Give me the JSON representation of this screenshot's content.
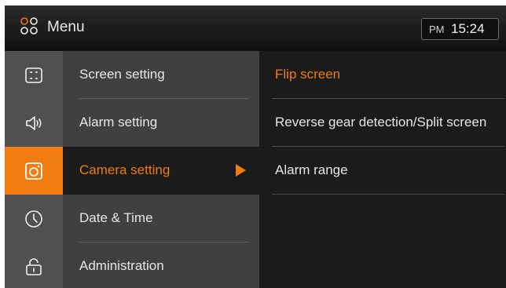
{
  "header": {
    "title": "Menu",
    "menu_icon": "grid-circles-icon",
    "clock": {
      "ampm": "PM",
      "time": "15:24"
    }
  },
  "sidebar": {
    "items": [
      {
        "icon": "screen-icon",
        "label": "Screen setting"
      },
      {
        "icon": "speaker-icon",
        "label": "Alarm setting"
      },
      {
        "icon": "camera-icon",
        "label": "Camera setting"
      },
      {
        "icon": "clock-icon",
        "label": "Date & Time"
      },
      {
        "icon": "lock-icon",
        "label": "Administration"
      }
    ],
    "selected_index": 2
  },
  "submenu": {
    "items": [
      {
        "label": "Flip screen"
      },
      {
        "label": "Reverse gear detection/Split screen"
      },
      {
        "label": "Alarm range"
      }
    ],
    "selected_index": 0
  },
  "colors": {
    "accent": "#f07c12",
    "header_bg": "#111111",
    "icon_column_bg": "#505050",
    "menu_column_bg": "#404040",
    "submenu_bg": "#1b1b1b",
    "text": "#e6e6e6"
  }
}
